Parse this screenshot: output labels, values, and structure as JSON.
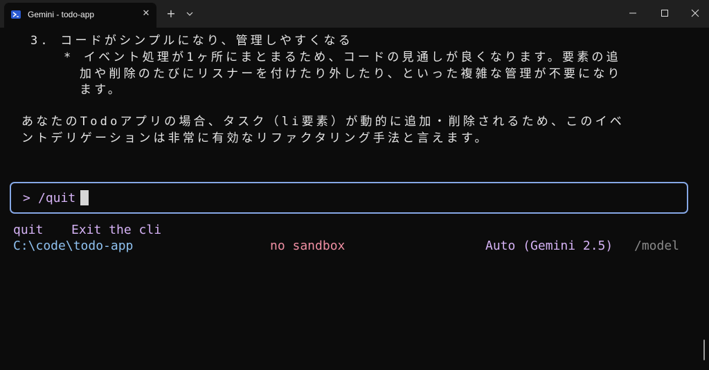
{
  "window": {
    "tab_title": "Gemini - todo-app",
    "tab_icon": "powershell-icon",
    "close_tab_glyph": "✕",
    "new_tab_glyph": "+",
    "controls": [
      "minimize-icon",
      "maximize-icon",
      "close-icon"
    ]
  },
  "output": {
    "item3": "3. コードがシンプルになり、管理しやすくなる",
    "bullet_line1": "* イベント処理が1ヶ所にまとまるため、コードの見通しが良くなります。要素の追",
    "bullet_line2": "加や削除のたびにリスナーを付けたり外したり、といった複雑な管理が不要になり",
    "bullet_line3": "ます。",
    "para_line1": "あなたのTodoアプリの場合、タスク（li要素）が動的に追加・削除されるため、このイベ",
    "para_line2": "ントデリゲーションは非常に有効なリファクタリング手法と言えます。"
  },
  "input": {
    "prompt": ">",
    "value": "/quit"
  },
  "suggestion": {
    "command": "quit",
    "description": "Exit the cli"
  },
  "status": {
    "path": "C:\\code\\todo-app",
    "sandbox": "no sandbox",
    "model": "Auto (Gemini 2.5)",
    "model_command": "/model"
  },
  "colors": {
    "background": "#0c0c0c",
    "titlebar": "#202020",
    "input_border": "#86a8e6",
    "accent_purple": "#d5b2f5",
    "path_blue": "#8fc1f0",
    "sandbox_red": "#f08fa3",
    "muted_gray": "#8a8a8a"
  }
}
